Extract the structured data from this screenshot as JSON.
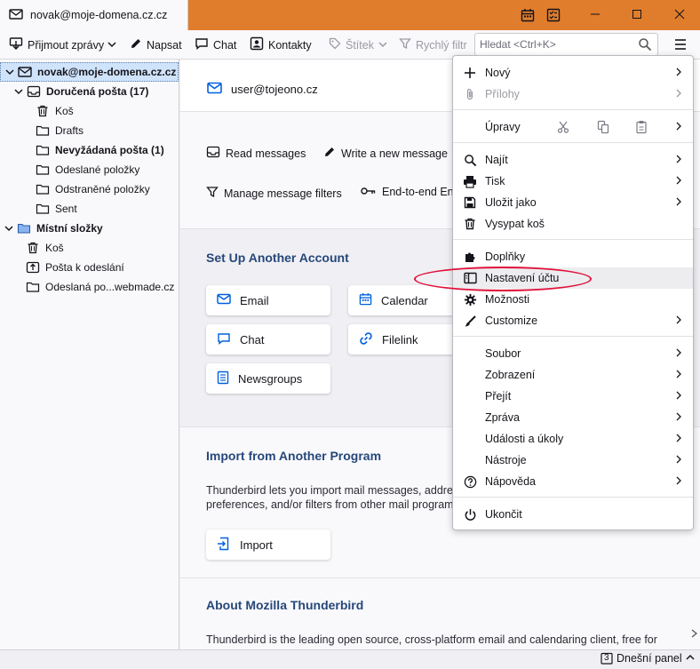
{
  "tab": {
    "title": "novak@moje-domena.cz.cz"
  },
  "toolbar": {
    "get_messages": "Přijmout zprávy",
    "write": "Napsat",
    "chat": "Chat",
    "contacts": "Kontakty",
    "tag": "Štítek",
    "quick_filter": "Rychlý filtr",
    "search_placeholder": "Hledat <Ctrl+K>"
  },
  "folders": [
    {
      "label": "novak@moje-domena.cz.cz",
      "icon": "mail-account-icon",
      "bold": true,
      "selected": true,
      "twisty": "down"
    },
    {
      "label": "Doručená pošta (17)",
      "icon": "inbox-icon",
      "bold": true,
      "twisty": "down"
    },
    {
      "label": "Koš",
      "icon": "trash-icon"
    },
    {
      "label": "Drafts",
      "icon": "folder-icon"
    },
    {
      "label": "Nevyžádaná pošta (1)",
      "icon": "folder-icon",
      "bold": true
    },
    {
      "label": "Odeslané položky",
      "icon": "folder-icon"
    },
    {
      "label": "Odstraněné položky",
      "icon": "folder-icon"
    },
    {
      "label": "Sent",
      "icon": "folder-icon"
    },
    {
      "label": "Místní složky",
      "icon": "local-folders-icon",
      "bold": true,
      "twisty": "down"
    },
    {
      "label": "Koš",
      "icon": "trash-icon"
    },
    {
      "label": "Pošta k odeslání",
      "icon": "outbox-icon"
    },
    {
      "label": "Odeslaná po...webmade.cz",
      "icon": "folder-icon"
    }
  ],
  "account": {
    "email": "user@tojeono.cz"
  },
  "actions": {
    "read": "Read messages",
    "write": "Write a new message",
    "filters": "Manage message filters",
    "e2e": "End-to-end Enc"
  },
  "setup": {
    "heading": "Set Up Another Account",
    "email": "Email",
    "calendar": "Calendar",
    "chat": "Chat",
    "filelink": "Filelink",
    "newsgroups": "Newsgroups"
  },
  "import": {
    "heading": "Import from Another Program",
    "line1": "Thunderbird lets you import mail messages, address",
    "line2": "preferences, and/or filters from other mail programs",
    "button": "Import"
  },
  "about": {
    "heading": "About Mozilla Thunderbird",
    "line1": "Thunderbird is the leading open source, cross-platform email and calendaring client, free for"
  },
  "statusbar": {
    "today_pane": "Dnešní panel",
    "today_day": "3"
  },
  "menu": {
    "new": "Nový",
    "attachments": "Přílohy",
    "edit": "Úpravy",
    "find": "Najít",
    "print": "Tisk",
    "save_as": "Uložit jako",
    "empty_trash": "Vysypat koš",
    "addons": "Doplňky",
    "account_settings": "Nastavení účtu",
    "options": "Možnosti",
    "customize": "Customize",
    "file": "Soubor",
    "view": "Zobrazení",
    "go": "Přejít",
    "message": "Zpráva",
    "events": "Události a úkoly",
    "tools": "Nástroje",
    "help": "Nápověda",
    "quit": "Ukončit"
  },
  "colors": {
    "titlebar": "#e07d2d",
    "accent": "#0060df",
    "heading": "#26477a",
    "highlight": "#e0113a"
  }
}
